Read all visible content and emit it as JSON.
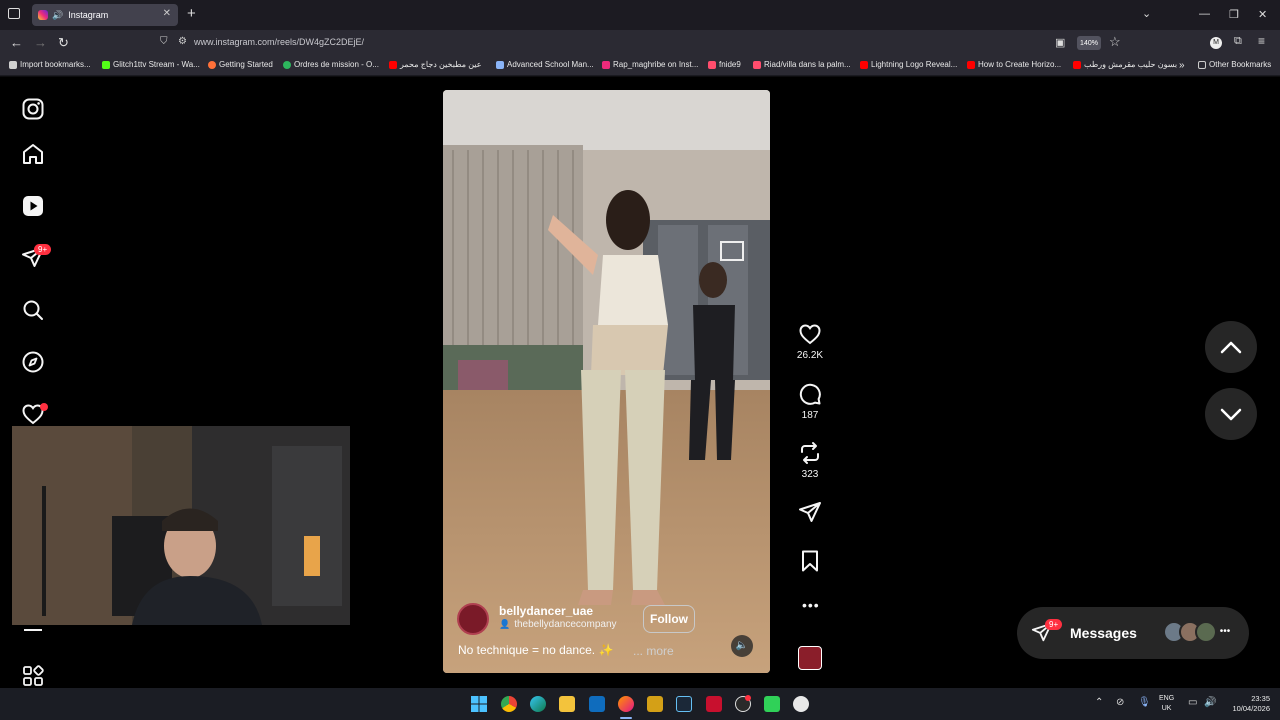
{
  "browser": {
    "tab_title": "Instagram",
    "url": "www.instagram.com/reels/DW4gZC2DEjE/",
    "zoom": "140%",
    "bookmarks": [
      {
        "label": "Import bookmarks...",
        "color": "#d0d0d0"
      },
      {
        "label": "Glitch1ttv Stream - Wa...",
        "color": "#53fc18"
      },
      {
        "label": "Getting Started",
        "color": "#ff7139"
      },
      {
        "label": "Ordres de mission - O...",
        "color": "#2db55d"
      },
      {
        "label": "عين مطبخين دجاج محمر",
        "color": "#ff0000"
      },
      {
        "label": "Advanced School Man...",
        "color": "#8ab4f8"
      },
      {
        "label": "Rap_maghribe on Inst...",
        "color": "#ee2a7b"
      },
      {
        "label": "fnide9",
        "color": "#ff4d6d"
      },
      {
        "label": "Riad/villa dans la palm...",
        "color": "#ff4d6d"
      },
      {
        "label": "Lightning Logo Reveal...",
        "color": "#ff0000"
      },
      {
        "label": "How to Create Horizo...",
        "color": "#ff0000"
      },
      {
        "label": "بسون حليب مقرمش ورطب",
        "color": "#ff0000"
      }
    ],
    "other_bookmarks": "Other Bookmarks"
  },
  "sidebar": {
    "notifications_badge": "9+"
  },
  "reel": {
    "username": "bellydancer_uae",
    "audio_label": "thebellydancecompany",
    "follow_label": "Follow",
    "caption": "No technique = no dance. ✨",
    "more_label": "... more"
  },
  "actions": {
    "likes": "26.2K",
    "comments": "187",
    "reposts": "323"
  },
  "messages": {
    "label": "Messages",
    "badge": "9+"
  },
  "taskbar": {
    "lang_top": "ENG",
    "lang_bottom": "UK",
    "time": "23:35",
    "date": "10/04/2026"
  }
}
